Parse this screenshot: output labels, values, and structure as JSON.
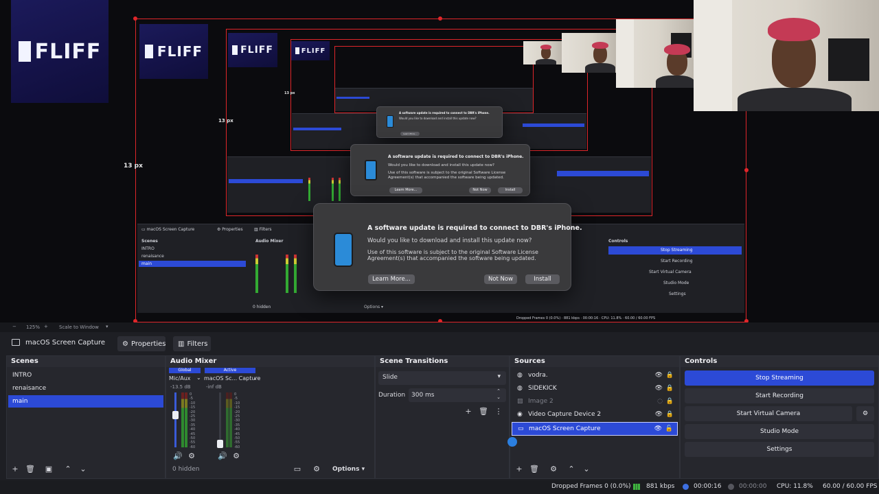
{
  "logo_text": "FLIFF",
  "preview": {
    "px_labels": [
      "13 px",
      "13 px",
      "13 px"
    ],
    "zoom": "125%",
    "scale_mode": "Scale to Window"
  },
  "dialog": {
    "title": "A software update is required to connect to DBR's iPhone.",
    "question": "Would you like to download and install this update now?",
    "license_line1": "Use of this software is subject to the original Software License",
    "license_line2": "Agreement(s) that accompanied the software being updated.",
    "learn_more": "Learn More...",
    "not_now": "Not Now",
    "install": "Install"
  },
  "source_toolbar": {
    "current_source": "macOS Screen Capture",
    "properties": "Properties",
    "filters": "Filters"
  },
  "scenes": {
    "title": "Scenes",
    "items": [
      "INTRO",
      "renaisance",
      "main"
    ],
    "selected": "main"
  },
  "audio_mixer": {
    "title": "Audio Mixer",
    "tab_global": "Global",
    "tab_active": "Active",
    "channel1": {
      "name": "Mic/Aux",
      "db": "-13.5 dB"
    },
    "channel2": {
      "name": "macOS Sc... Capture",
      "db": "-inf dB"
    },
    "scale": [
      "0",
      "-5",
      "-10",
      "-15",
      "-20",
      "-25",
      "-30",
      "-35",
      "-40",
      "-45",
      "-50",
      "-55",
      "-60"
    ],
    "hidden": "0 hidden",
    "options": "Options"
  },
  "scene_transitions": {
    "title": "Scene Transitions",
    "transition": "Slide",
    "duration_label": "Duration",
    "duration_value": "300 ms"
  },
  "sources": {
    "title": "Sources",
    "items": [
      {
        "name": "vodra.",
        "icon": "globe-icon",
        "visible": true,
        "locked": false
      },
      {
        "name": "SIDEKICK",
        "icon": "globe-icon",
        "visible": true,
        "locked": false
      },
      {
        "name": "Image 2",
        "icon": "image-icon",
        "visible": false,
        "locked": false
      },
      {
        "name": "Video Capture Device 2",
        "icon": "camera-icon",
        "visible": true,
        "locked": false
      },
      {
        "name": "macOS Screen Capture",
        "icon": "monitor-icon",
        "visible": true,
        "locked": false
      }
    ],
    "selected": "macOS Screen Capture"
  },
  "controls": {
    "title": "Controls",
    "stop_streaming": "Stop Streaming",
    "start_recording": "Start Recording",
    "start_virtual_camera": "Start Virtual Camera",
    "studio_mode": "Studio Mode",
    "settings": "Settings"
  },
  "status": {
    "dropped_frames": "Dropped Frames 0 (0.0%)",
    "bitrate": "881 kbps",
    "stream_time": "00:00:16",
    "record_time": "00:00:00",
    "cpu": "CPU: 11.8%",
    "fps": "60.00 / 60.00 FPS"
  },
  "colors": {
    "accent": "#2c4ad6",
    "frame_red": "#e0262a",
    "panel_bg": "#26272d",
    "brand_purple": "#1b1a5a"
  }
}
